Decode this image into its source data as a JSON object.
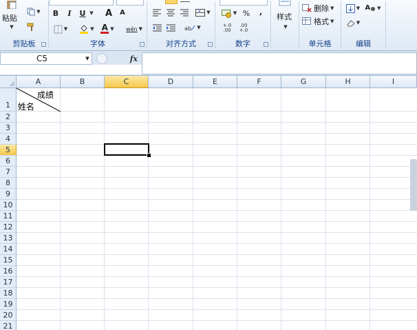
{
  "ribbon": {
    "clipboard": {
      "paste_label": "粘贴",
      "group_label": "剪贴板"
    },
    "font": {
      "bold": "B",
      "italic": "I",
      "underline": "U",
      "grow_font": "A",
      "shrink_font": "A",
      "font_color_letter": "A",
      "phonetic": "wén",
      "group_label": "字体",
      "font_color": "#d11a1a",
      "highlight_color": "#ffd400"
    },
    "alignment": {
      "group_label": "对齐方式"
    },
    "number": {
      "percent": "%",
      "comma": ",",
      "inc_decimal": "+.0 .00",
      "dec_decimal": ".00 +.0",
      "group_label": "数字"
    },
    "styles": {
      "styles_label": "样式"
    },
    "cells": {
      "delete_label": "删除",
      "format_label": "格式",
      "group_label": "单元格"
    },
    "editing": {
      "find_glyph": "A",
      "group_label": "编辑"
    }
  },
  "formula_bar": {
    "name_box": "C5",
    "fx_label": "fx",
    "formula": ""
  },
  "sheet": {
    "columns": [
      "A",
      "B",
      "C",
      "D",
      "E",
      "F",
      "G",
      "H",
      "I"
    ],
    "active_column": "C",
    "rows": [
      "1",
      "2",
      "3",
      "4",
      "5",
      "6",
      "7",
      "8",
      "9",
      "10",
      "11",
      "12",
      "13",
      "14",
      "15",
      "16",
      "17",
      "18",
      "19",
      "20",
      "21"
    ],
    "active_row": "5",
    "cell_a1": {
      "top_right": "成绩",
      "bottom_left": "姓名"
    },
    "selected_cell": "C5"
  },
  "colors": {
    "ribbon_bg": "#dfe9f5",
    "header_active": "#f5c84a",
    "grid_line": "#dae1ea",
    "header_border": "#9eb6ce"
  }
}
